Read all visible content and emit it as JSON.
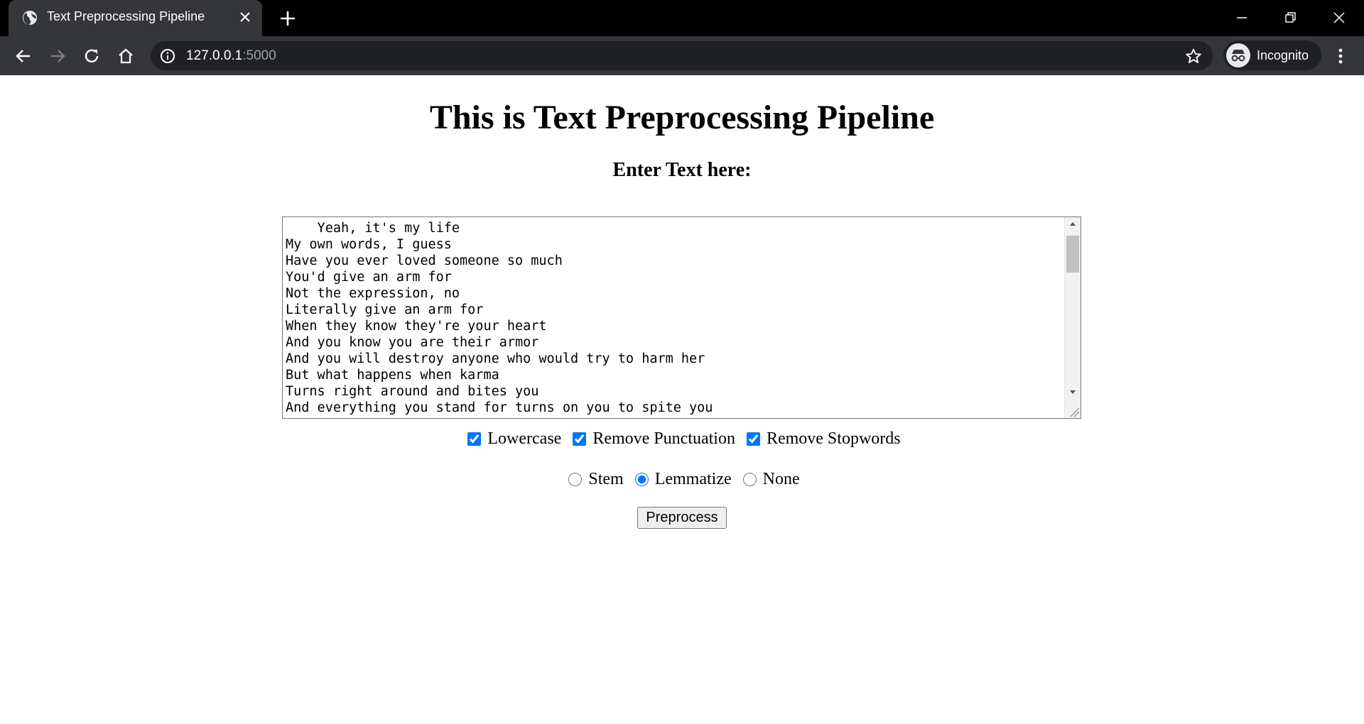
{
  "browser": {
    "tab_title": "Text Preprocessing Pipeline",
    "url_host": "127.0.0.1",
    "url_port": ":5000",
    "profile_label": "Incognito",
    "icons": {
      "favicon": "globe-icon",
      "tab_close": "close-icon",
      "new_tab": "plus-icon",
      "back": "arrow-left-icon",
      "forward": "arrow-right-icon",
      "reload": "reload-icon",
      "home": "home-icon",
      "info": "info-icon",
      "bookmark": "star-icon",
      "profile": "incognito-icon",
      "menu": "kebab-menu-icon",
      "minimize": "minimize-icon",
      "restore": "restore-icon",
      "close_window": "close-icon"
    }
  },
  "page": {
    "heading": "This is Text Preprocessing Pipeline",
    "subheading": "Enter Text here:",
    "input_text": "    Yeah, it's my life\nMy own words, I guess\nHave you ever loved someone so much\nYou'd give an arm for\nNot the expression, no\nLiterally give an arm for\nWhen they know they're your heart\nAnd you know you are their armor\nAnd you will destroy anyone who would try to harm her\nBut what happens when karma\nTurns right around and bites you\nAnd everything you stand for turns on you to spite you",
    "checkboxes": [
      {
        "label": "Lowercase",
        "checked": true
      },
      {
        "label": "Remove Punctuation",
        "checked": true
      },
      {
        "label": "Remove Stopwords",
        "checked": true
      }
    ],
    "radios": [
      {
        "label": "Stem",
        "checked": false
      },
      {
        "label": "Lemmatize",
        "checked": true
      },
      {
        "label": "None",
        "checked": false
      }
    ],
    "submit_label": "Preprocess",
    "accent_color": "#0075ff"
  }
}
